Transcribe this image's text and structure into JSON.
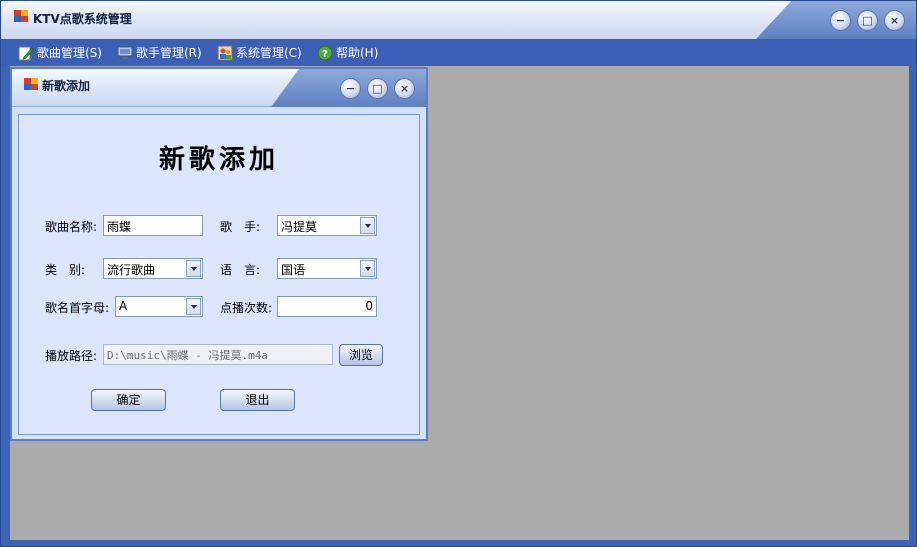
{
  "app": {
    "title": "KTV点歌系统管理",
    "window_controls": {
      "minimize": "−",
      "maximize": "□",
      "close": "×"
    }
  },
  "menu": {
    "items": [
      {
        "label": "歌曲管理(S)",
        "icon": "song-edit-icon"
      },
      {
        "label": "歌手管理(R)",
        "icon": "singer-monitor-icon"
      },
      {
        "label": "系统管理(C)",
        "icon": "users-icon"
      },
      {
        "label": "帮助(H)",
        "icon": "help-icon"
      }
    ]
  },
  "child_window": {
    "title": "新歌添加",
    "window_controls": {
      "minimize": "−",
      "maximize": "□",
      "close": "×"
    }
  },
  "form": {
    "heading": "新歌添加",
    "song_name": {
      "label": "歌曲名称:",
      "value": "雨蝶"
    },
    "singer": {
      "label": "歌　手:",
      "value": "冯提莫"
    },
    "category": {
      "label": "类　别:",
      "value": "流行歌曲"
    },
    "language": {
      "label": "语　言:",
      "value": "国语"
    },
    "initial": {
      "label": "歌名首字母:",
      "value": "A"
    },
    "play_count": {
      "label": "点播次数:",
      "value": "0"
    },
    "path": {
      "label": "播放路径:",
      "value": "D:\\music\\雨蝶 - 冯提莫.m4a"
    },
    "browse_label": "浏览",
    "confirm_label": "确定",
    "exit_label": "退出"
  },
  "colors": {
    "menubar": "#3a5fb4",
    "mdi_background": "#ababab",
    "form_background": "#dbe6fb"
  }
}
